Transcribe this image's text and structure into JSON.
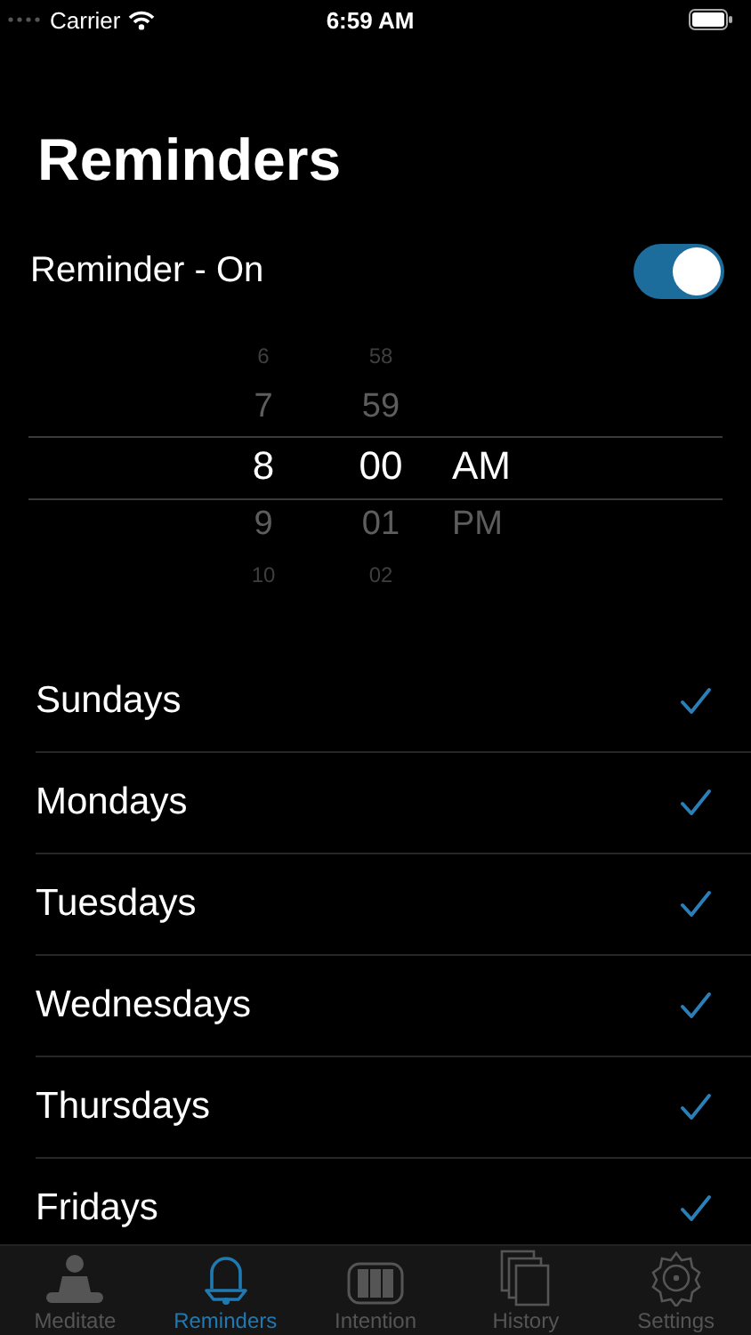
{
  "status_bar": {
    "carrier": "Carrier",
    "time": "6:59 AM"
  },
  "title": "Reminders",
  "reminder": {
    "label": "Reminder - On",
    "on": true
  },
  "picker": {
    "columns": [
      {
        "items": [
          {
            "text": "6",
            "selected": false
          },
          {
            "text": "7",
            "selected": false
          },
          {
            "text": "8",
            "selected": true
          },
          {
            "text": "9",
            "selected": false
          },
          {
            "text": "10",
            "selected": false
          }
        ]
      },
      {
        "items": [
          {
            "text": "58",
            "selected": false
          },
          {
            "text": "59",
            "selected": false
          },
          {
            "text": "00",
            "selected": true
          },
          {
            "text": "01",
            "selected": false
          },
          {
            "text": "02",
            "selected": false
          }
        ]
      },
      {
        "items": [
          {
            "text": "AM",
            "selected": true
          },
          {
            "text": "PM",
            "selected": false
          }
        ]
      }
    ]
  },
  "days": [
    {
      "label": "Sundays",
      "checked": true
    },
    {
      "label": "Mondays",
      "checked": true
    },
    {
      "label": "Tuesdays",
      "checked": true
    },
    {
      "label": "Wednesdays",
      "checked": true
    },
    {
      "label": "Thursdays",
      "checked": true
    },
    {
      "label": "Fridays",
      "checked": true
    }
  ],
  "tabs": [
    {
      "label": "Meditate",
      "kind": "meditate",
      "selected": false
    },
    {
      "label": "Reminders",
      "kind": "bell",
      "selected": true
    },
    {
      "label": "Intention",
      "kind": "intention",
      "selected": false
    },
    {
      "label": "History",
      "kind": "history",
      "selected": false
    },
    {
      "label": "Settings",
      "kind": "settings",
      "selected": false
    }
  ]
}
